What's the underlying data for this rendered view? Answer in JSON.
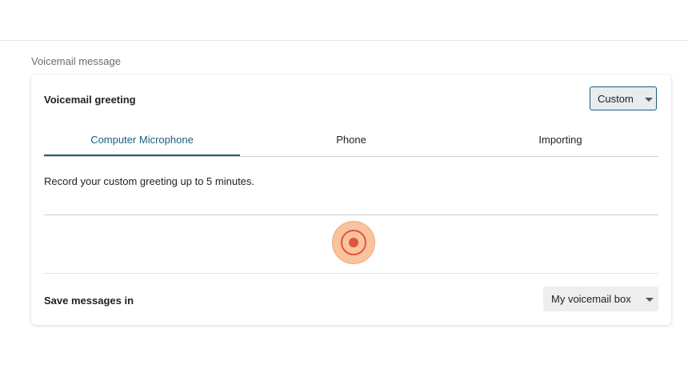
{
  "section": {
    "title": "Voicemail message"
  },
  "greeting": {
    "label": "Voicemail greeting",
    "selected": "Custom"
  },
  "tabs": [
    {
      "label": "Computer Microphone",
      "active": true
    },
    {
      "label": "Phone",
      "active": false
    },
    {
      "label": "Importing",
      "active": false
    }
  ],
  "recording": {
    "description": "Record your custom greeting up to 5 minutes.",
    "record_icon": "record-icon"
  },
  "save": {
    "label": "Save messages in",
    "selected": "My voicemail box"
  },
  "colors": {
    "accent": "#1f5e7b",
    "record_red": "#e0553c",
    "record_halo": "#f9c39e"
  }
}
